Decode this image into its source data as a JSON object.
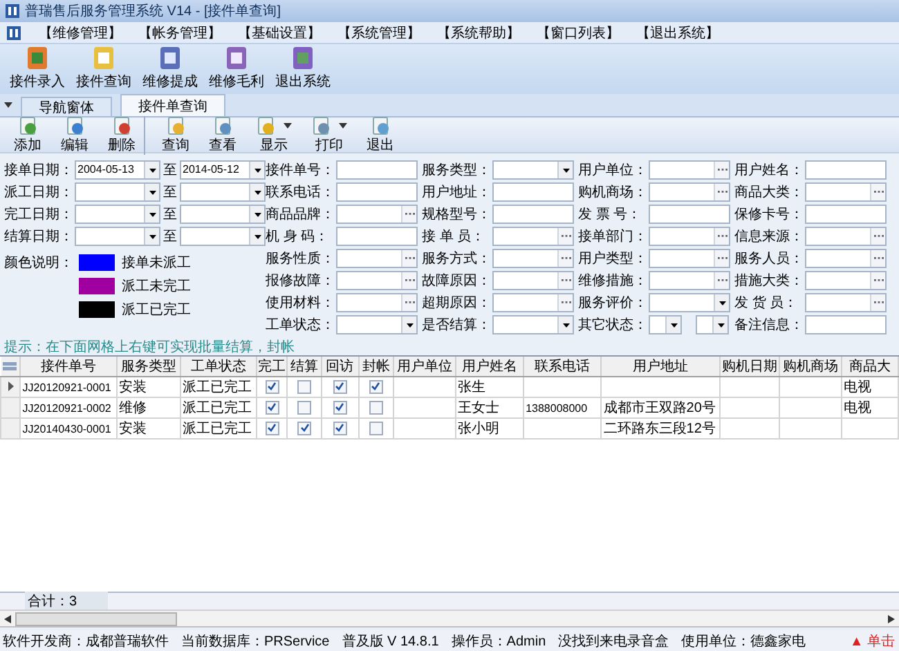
{
  "window": {
    "title": "普瑞售后服务管理系统 V14 - [接件单查询]"
  },
  "menu": [
    "【维修管理】",
    "【帐务管理】",
    "【基础设置】",
    "【系统管理】",
    "【系统帮助】",
    "【窗口列表】",
    "【退出系统】"
  ],
  "main_toolbar": [
    "接件录入",
    "接件查询",
    "维修提成",
    "维修毛利",
    "退出系统"
  ],
  "tabs": [
    {
      "label": "导航窗体",
      "selected": false
    },
    {
      "label": "接件单查询",
      "selected": true
    }
  ],
  "toolbar": [
    {
      "label": "添加",
      "has_menu": false,
      "separator_after": false
    },
    {
      "label": "编辑",
      "has_menu": false,
      "separator_after": false
    },
    {
      "label": "删除",
      "has_menu": false,
      "separator_after": true
    },
    {
      "label": "查询",
      "has_menu": false,
      "separator_after": false
    },
    {
      "label": "查看",
      "has_menu": false,
      "separator_after": false
    },
    {
      "label": "显示",
      "has_menu": true,
      "separator_after": false
    },
    {
      "label": "打印",
      "has_menu": true,
      "separator_after": false
    },
    {
      "label": "退出",
      "has_menu": false,
      "separator_after": false
    }
  ],
  "date_filters": [
    {
      "label": "接单日期：",
      "from": "2004-05-13",
      "to_label": "至",
      "to": "2014-05-12"
    },
    {
      "label": "派工日期：",
      "to_label": "至"
    },
    {
      "label": "完工日期：",
      "to_label": "至"
    },
    {
      "label": "结算日期：",
      "to_label": "至"
    }
  ],
  "legend": {
    "label": "颜色说明：",
    "items": [
      {
        "color": "#0000ff",
        "label": "接单未派工"
      },
      {
        "color": "#a000a0",
        "label": "派工未完工"
      },
      {
        "color": "#000000",
        "label": "派工已完工"
      }
    ]
  },
  "hint": "提示：在下面网格上右键可实现批量结算，封帐",
  "field_columns": [
    [
      {
        "label": "接件单号：",
        "kind": "text"
      },
      {
        "label": "联系电话：",
        "kind": "text"
      },
      {
        "label": "商品品牌：",
        "kind": "browse"
      },
      {
        "label": "机 身 码：",
        "kind": "text"
      },
      {
        "label": "服务性质：",
        "kind": "browse"
      },
      {
        "label": "报修故障：",
        "kind": "browse"
      },
      {
        "label": "使用材料：",
        "kind": "browse"
      },
      {
        "label": "工单状态：",
        "kind": "dropdown"
      }
    ],
    [
      {
        "label": "服务类型：",
        "kind": "dropdown"
      },
      {
        "label": "用户地址：",
        "kind": "text"
      },
      {
        "label": "规格型号：",
        "kind": "text"
      },
      {
        "label": "接 单 员：",
        "kind": "browse"
      },
      {
        "label": "服务方式：",
        "kind": "browse"
      },
      {
        "label": "故障原因：",
        "kind": "browse"
      },
      {
        "label": "超期原因：",
        "kind": "browse"
      },
      {
        "label": "是否结算：",
        "kind": "dropdown"
      }
    ],
    [
      {
        "label": "用户单位：",
        "kind": "browse"
      },
      {
        "label": "购机商场：",
        "kind": "browse"
      },
      {
        "label": "发 票 号：",
        "kind": "text"
      },
      {
        "label": "接单部门：",
        "kind": "browse"
      },
      {
        "label": "用户类型：",
        "kind": "browse"
      },
      {
        "label": "维修措施：",
        "kind": "browse"
      },
      {
        "label": "服务评价：",
        "kind": "dropdown"
      },
      {
        "label": "其它状态：",
        "kind": "double-dropdown"
      }
    ],
    [
      {
        "label": "用户姓名：",
        "kind": "text"
      },
      {
        "label": "商品大类：",
        "kind": "browse"
      },
      {
        "label": "保修卡号：",
        "kind": "text"
      },
      {
        "label": "信息来源：",
        "kind": "browse"
      },
      {
        "label": "服务人员：",
        "kind": "browse"
      },
      {
        "label": "措施大类：",
        "kind": "browse"
      },
      {
        "label": "发 货 员：",
        "kind": "browse"
      },
      {
        "label": "备注信息：",
        "kind": "text"
      }
    ]
  ],
  "table": {
    "columns": [
      {
        "label": "接件单号",
        "kind": "text"
      },
      {
        "label": "服务类型",
        "kind": "text"
      },
      {
        "label": "工单状态",
        "kind": "text"
      },
      {
        "label": "完工",
        "kind": "check"
      },
      {
        "label": "结算",
        "kind": "check"
      },
      {
        "label": "回访",
        "kind": "check"
      },
      {
        "label": "封帐",
        "kind": "check"
      },
      {
        "label": "用户单位",
        "kind": "text"
      },
      {
        "label": "用户姓名",
        "kind": "text"
      },
      {
        "label": "联系电话",
        "kind": "text"
      },
      {
        "label": "用户地址",
        "kind": "text"
      },
      {
        "label": "购机日期",
        "kind": "text"
      },
      {
        "label": "购机商场",
        "kind": "text"
      },
      {
        "label": "商品大",
        "kind": "text"
      }
    ],
    "rows": [
      {
        "selected": true,
        "cells": [
          "JJ20120921-0001",
          "安装",
          "派工已完工",
          true,
          false,
          true,
          true,
          null,
          "张生",
          null,
          null,
          null,
          null,
          "电视"
        ]
      },
      {
        "selected": false,
        "cells": [
          "JJ20120921-0002",
          "维修",
          "派工已完工",
          true,
          false,
          true,
          false,
          null,
          "王女士",
          "1388008000",
          "成都市王双路20号",
          null,
          null,
          "电视"
        ]
      },
      {
        "selected": false,
        "cells": [
          "JJ20140430-0001",
          "安装",
          "派工已完工",
          true,
          true,
          true,
          false,
          null,
          "张小明",
          null,
          "二环路东三段12号",
          null,
          null,
          null
        ]
      }
    ]
  },
  "total": "合计：3",
  "status_bar": [
    "软件开发商：成都普瑞软件",
    "当前数据库：PRService",
    "普及版 V 14.8.1",
    "操作员：Admin",
    "没找到来电录音盒",
    "使用单位：德鑫家电"
  ],
  "status_link": "▲ 单击"
}
